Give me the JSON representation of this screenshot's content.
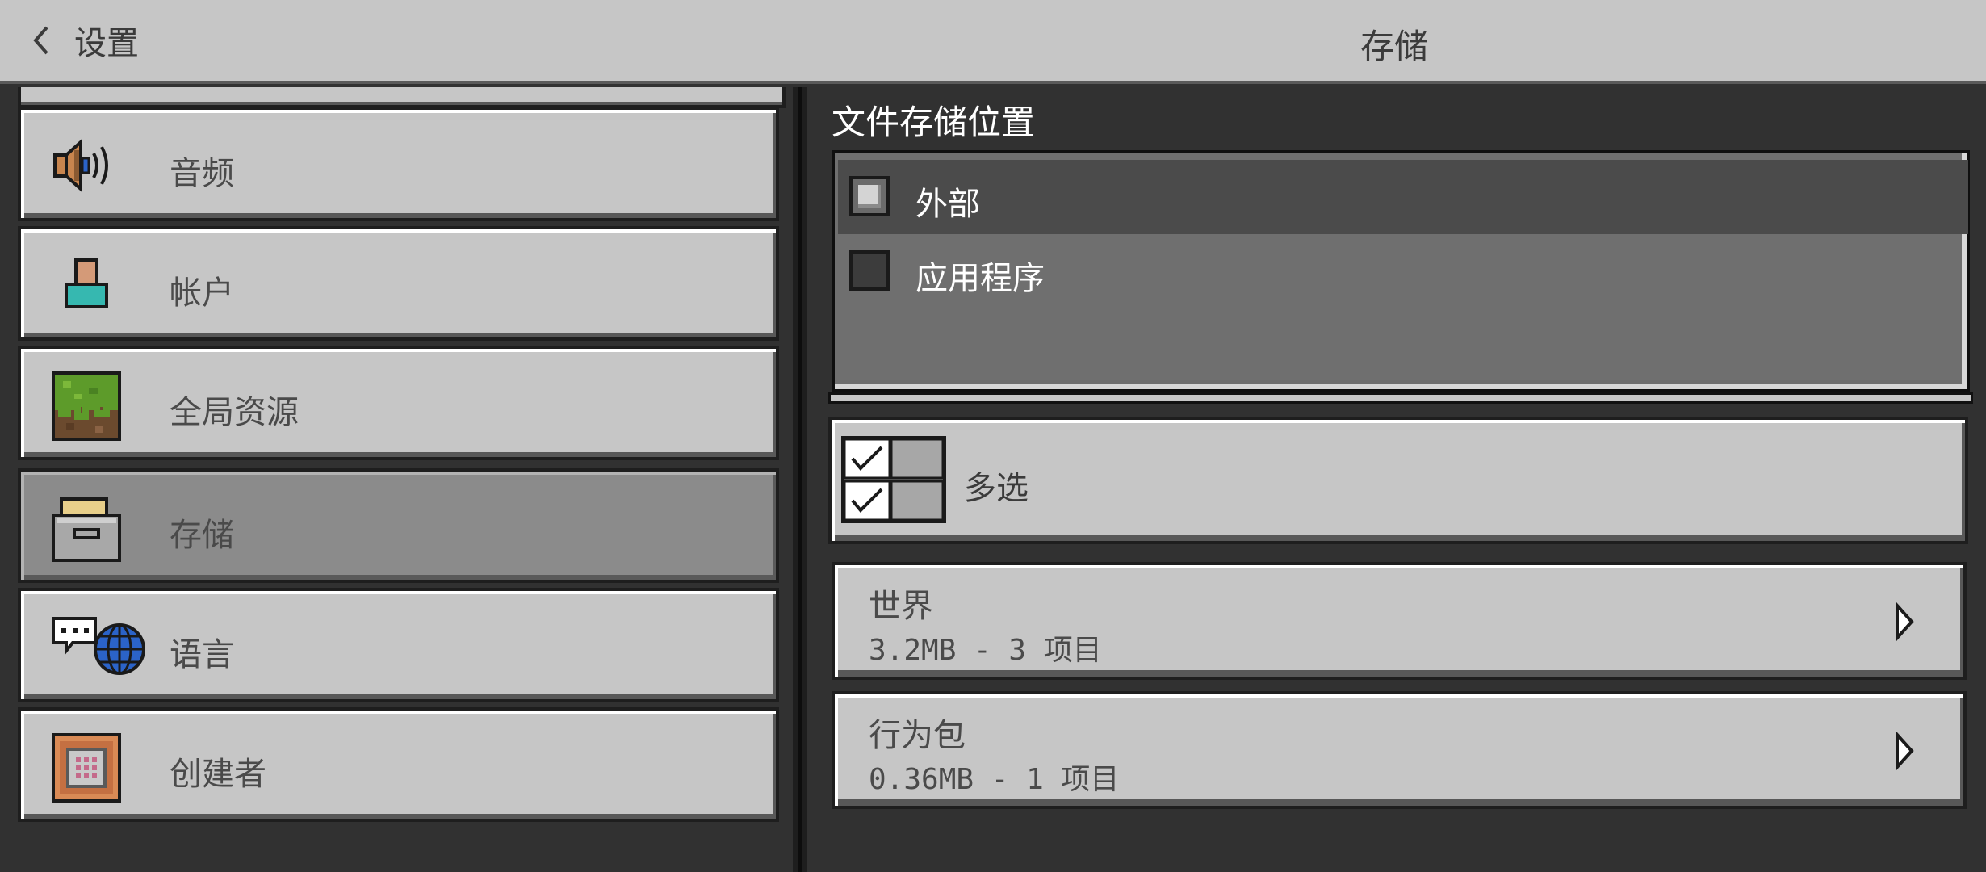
{
  "header": {
    "back_label": "设置",
    "title": "存储"
  },
  "nav": {
    "items": [
      {
        "label": "音频",
        "icon": "speaker-icon"
      },
      {
        "label": "帐户",
        "icon": "account-icon"
      },
      {
        "label": "全局资源",
        "icon": "grass-block-icon"
      },
      {
        "label": "存储",
        "icon": "storage-drawer-icon",
        "selected": true
      },
      {
        "label": "语言",
        "icon": "language-globe-icon"
      },
      {
        "label": "创建者",
        "icon": "command-block-icon"
      }
    ]
  },
  "storage": {
    "section_title": "文件存储位置",
    "options": [
      {
        "label": "外部",
        "checked": true
      },
      {
        "label": "应用程序",
        "checked": false
      }
    ],
    "multi_select_label": "多选",
    "rows": [
      {
        "title": "世界",
        "subtitle": "3.2MB - 3 项目"
      },
      {
        "title": "行为包",
        "subtitle": "0.36MB - 1 项目"
      }
    ]
  },
  "colors": {
    "panel": "#c6c6c6",
    "background": "#313131",
    "selected_nav": "#8b8b8b",
    "radio_group": "#6f6f6f"
  }
}
